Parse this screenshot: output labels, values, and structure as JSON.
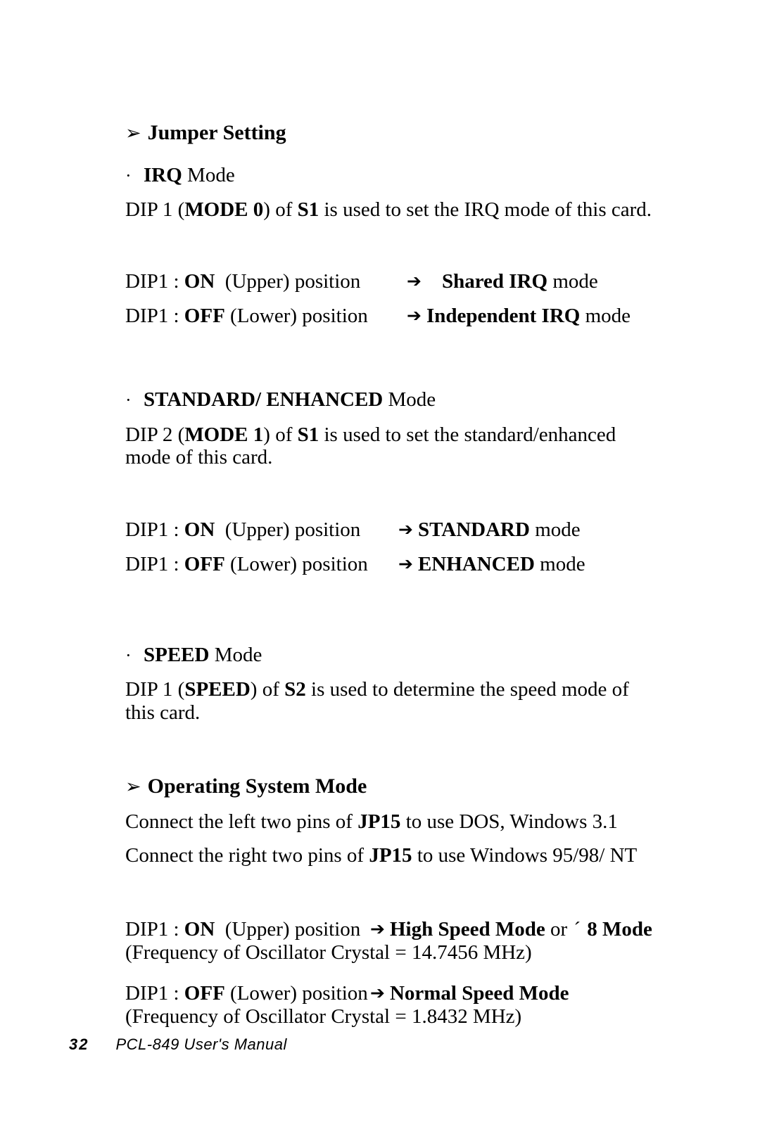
{
  "document": {
    "title": "PCL-849 User's Manual",
    "page_number": "32"
  },
  "sections": {
    "jumper_setting": {
      "heading": "Jumper Setting",
      "marker": "wingding-arrowhead-icon",
      "irq": {
        "bullet_label_bold": "IRQ",
        "bullet_label_rest": " Mode",
        "description_parts": {
          "p1": "DIP 1 (",
          "b1": "MODE 0",
          "p2": ") of ",
          "b2": "S1",
          "p3": " is used to set the IRQ mode of this card."
        },
        "rows": [
          {
            "prefix": "DIP1 : ",
            "state": "ON",
            "position": "  (Upper) position",
            "arrow": "arrow-right-icon",
            "result_bold": "Shared IRQ",
            "result_rest": " mode"
          },
          {
            "prefix": "DIP1 : ",
            "state": "OFF",
            "position": " (Lower) position",
            "arrow": "arrow-right-icon",
            "result_bold": "Independent IRQ",
            "result_rest": " mode"
          }
        ]
      },
      "standard_enhanced": {
        "bullet_label_bold": "STANDARD/ ENHANCED",
        "bullet_label_rest": " Mode",
        "description_parts": {
          "p1": "DIP 2 (",
          "b1": "MODE 1",
          "p2": ") of ",
          "b2": "S1",
          "p3": " is used to set the standard/enhanced mode of this card."
        },
        "rows": [
          {
            "prefix": "DIP1 : ",
            "state": "ON",
            "position": "  (Upper) position",
            "arrow": "arrow-right-icon",
            "result_bold": "STANDARD",
            "result_rest": " mode"
          },
          {
            "prefix": "DIP1 : ",
            "state": "OFF",
            "position": " (Lower) position",
            "arrow": "arrow-right-icon",
            "result_bold": "ENHANCED",
            "result_rest": " mode"
          }
        ]
      },
      "speed": {
        "bullet_label_bold": "SPEED",
        "bullet_label_rest": " Mode",
        "description_parts": {
          "p1": "DIP 1 (",
          "b1": "SPEED",
          "p2": ") of ",
          "b2": "S2",
          "p3": " is used to determine the speed mode of this card."
        }
      }
    },
    "operating_system_mode": {
      "heading": "Operating System Mode",
      "marker": "wingding-arrowhead-icon",
      "lines": [
        {
          "p1": "Connect the left two pins of ",
          "b1": "JP15",
          "p2": " to use DOS, Windows 3.1"
        },
        {
          "p1": "Connect the right two pins of ",
          "b1": "JP15",
          "p2": " to use Windows 95/98/ NT"
        }
      ],
      "speed_rows": [
        {
          "prefix": "DIP1 : ",
          "state": "ON",
          "position": "  (Upper) position",
          "arrow": "arrow-right-icon",
          "result_bold": "High Speed Mode",
          "result_mid": " or ",
          "result_symbol": "´",
          "result_bold2": " 8 Mode",
          "note": "(Frequency of Oscillator Crystal = 14.7456 MHz)"
        },
        {
          "prefix": "DIP1 : ",
          "state": "OFF",
          "position": " (Lower) position",
          "arrow": "arrow-right-icon",
          "result_bold": "Normal Speed Mode",
          "result_mid": "",
          "result_symbol": "",
          "result_bold2": "",
          "note": "(Frequency of Oscillator Crystal = 1.8432 MHz)"
        }
      ]
    }
  },
  "glyphs": {
    "wingding_arrow": "➢",
    "middle_dot": "·",
    "arrow_right": "➔"
  }
}
